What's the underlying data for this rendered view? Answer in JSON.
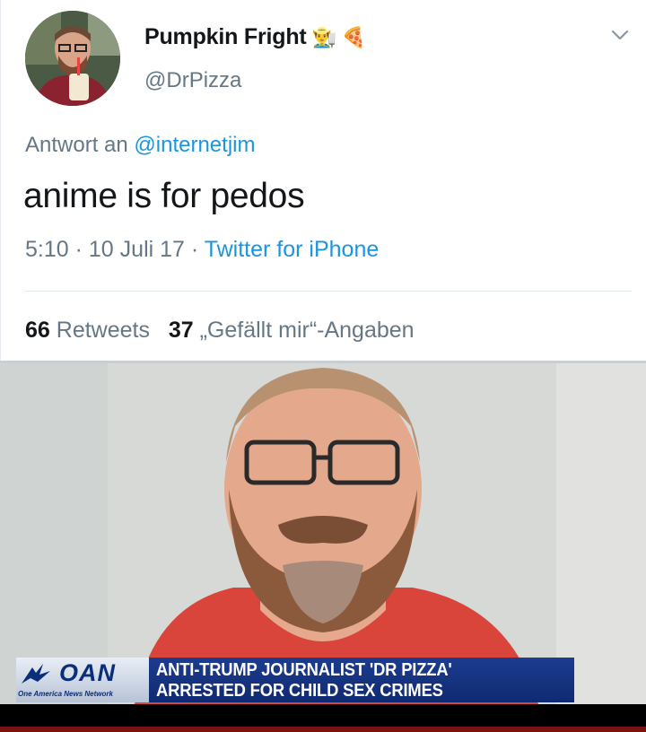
{
  "tweet": {
    "display_name": "Pumpkin Fright",
    "name_emojis": [
      "👨‍🌾",
      "🍕"
    ],
    "handle": "@DrPizza",
    "reply_prefix": "Antwort an",
    "reply_mention": "@internetjim",
    "text": "anime is for pedos",
    "time": "5:10",
    "sep1": "·",
    "date": "10 Juli 17",
    "sep2": "·",
    "source": "Twitter for iPhone",
    "retweet_count": "66",
    "retweet_label": "Retweets",
    "like_count": "37",
    "like_label": "„Gefällt mir“-Angaben",
    "menu_icon": "chevron-down-icon"
  },
  "news": {
    "logo": "OAN",
    "network": "One America News Network",
    "headline_line1": "ANTI-TRUMP JOURNALIST 'DR PIZZA'",
    "headline_line2": "ARRESTED FOR CHILD SEX CRIMES"
  },
  "colors": {
    "link": "#1b95e0",
    "muted": "#657786",
    "headline_bg": "#1d3c8f",
    "shirt": "#d9453a"
  }
}
